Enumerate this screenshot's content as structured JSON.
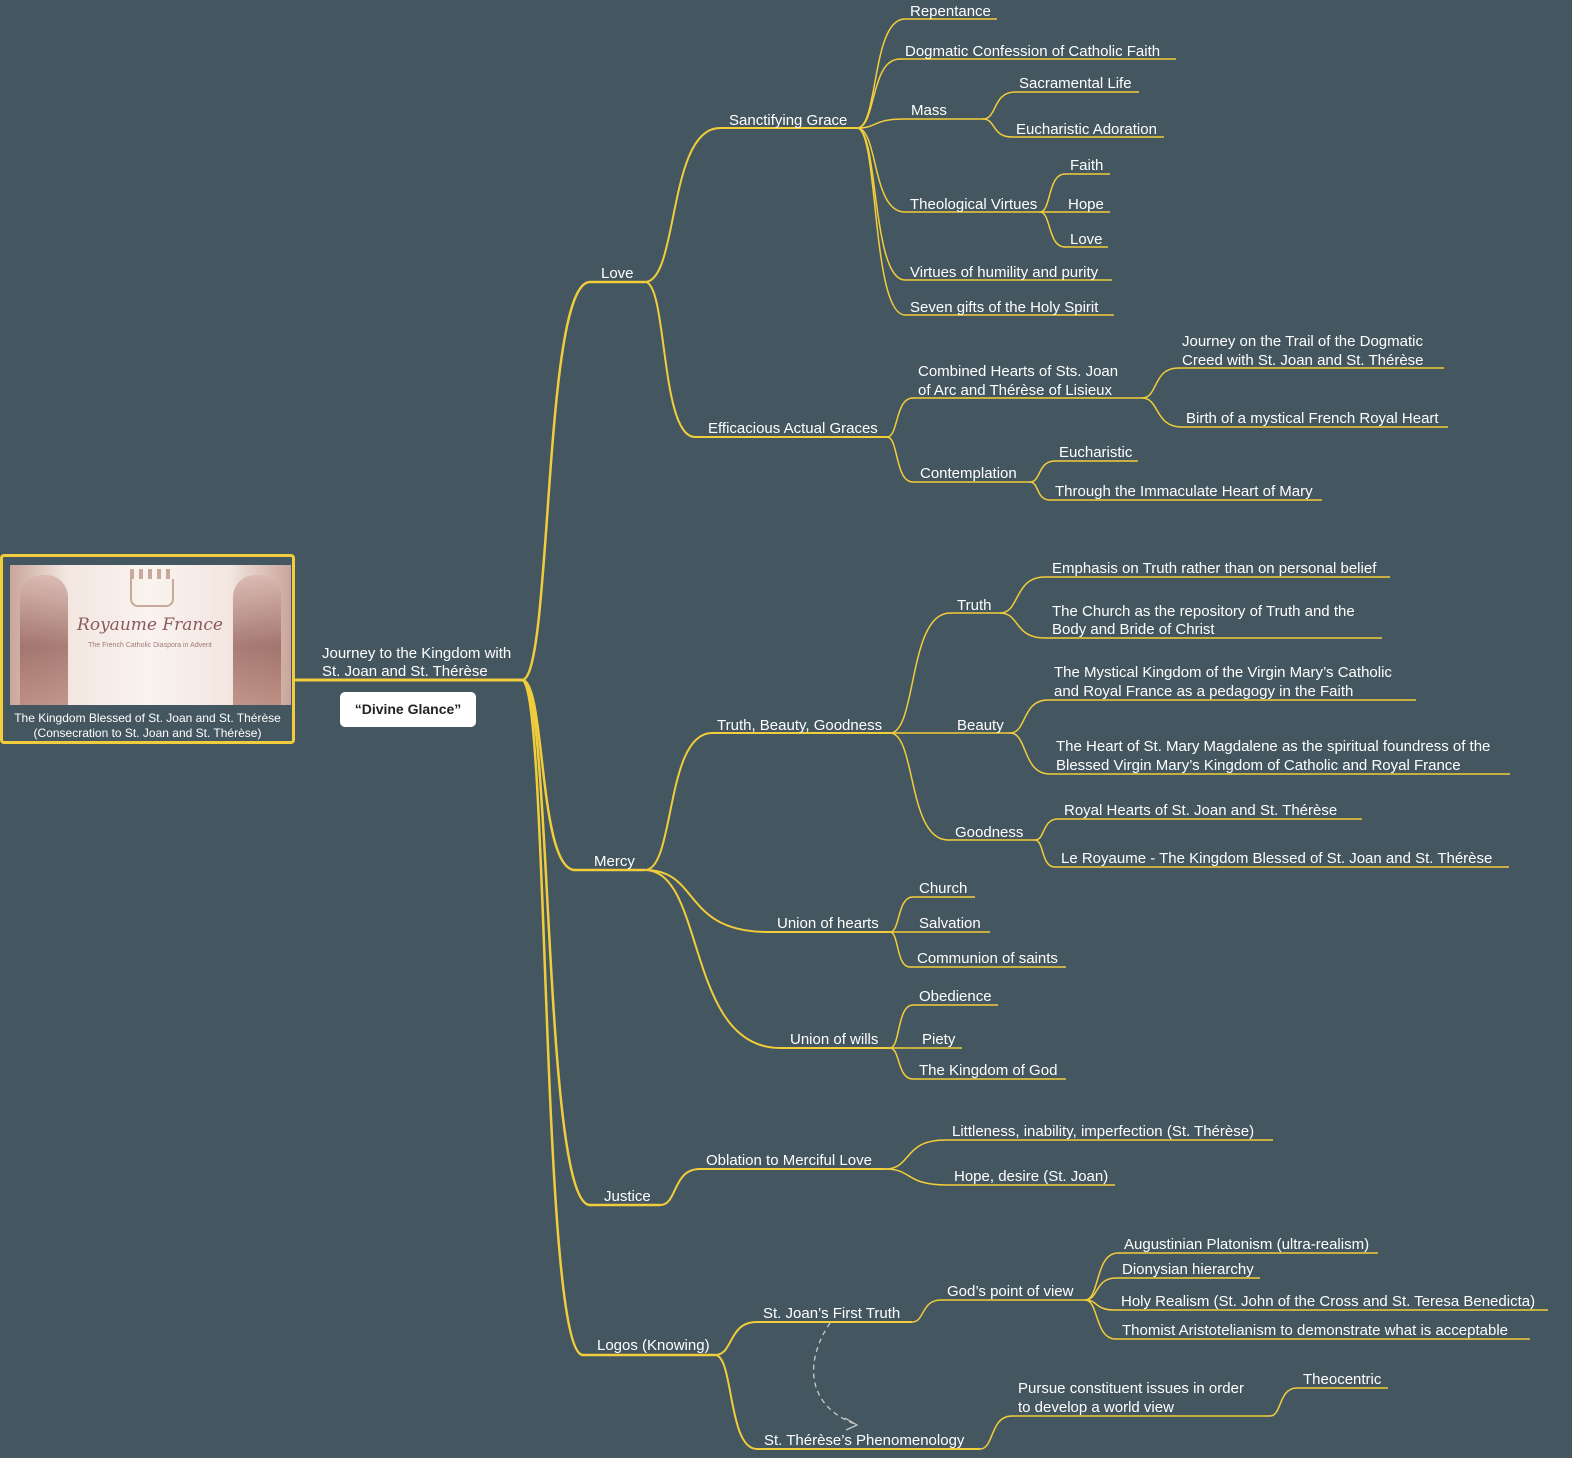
{
  "root": {
    "image_alt": "Royaume France image with St. Joan and St. Thérèse",
    "logo_title": "Royaume France",
    "logo_subtitle": "The French Catholic Diaspora in Advent",
    "caption_line1": "The Kingdom Blessed of St. Joan and St. Thérèse",
    "caption_line2": "(Consecration to St. Joan and St. Thérèse)"
  },
  "central_topic": {
    "line1": "Journey to the Kingdom with",
    "line2": "St. Joan and St. Thérèse"
  },
  "callout": "“Divine Glance”",
  "colors": {
    "background": "#44565f",
    "branch": "#f1cd3c",
    "text": "#ffffff"
  },
  "branches": {
    "love": "Love",
    "sanctifying_grace": "Sanctifying Grace",
    "repentance": "Repentance",
    "dogmatic_confession": "Dogmatic Confession of Catholic Faith",
    "mass": "Mass",
    "sacramental_life": "Sacramental Life",
    "eucharistic_adoration": "Eucharistic Adoration",
    "theological_virtues": "Theological Virtues",
    "faith": "Faith",
    "hope": "Hope",
    "love_virtue": "Love",
    "virtues_humility": "Virtues of humility and purity",
    "seven_gifts": "Seven gifts of the Holy Spirit",
    "efficacious_graces": "Efficacious Actual Graces",
    "combined_hearts_1": "Combined Hearts of Sts. Joan",
    "combined_hearts_2": "of Arc and Thérèse of Lisieux",
    "journey_trail_1": "Journey on the Trail of the Dogmatic",
    "journey_trail_2": "Creed with St. Joan and St. Thérèse",
    "birth_heart": "Birth of a mystical French Royal Heart",
    "contemplation": "Contemplation",
    "eucharistic": "Eucharistic",
    "through_heart": "Through the Immaculate Heart of Mary",
    "mercy": "Mercy",
    "tbg": "Truth, Beauty, Goodness",
    "truth": "Truth",
    "emphasis_truth": "Emphasis on Truth rather than on personal belief",
    "church_repo_1": "The Church as the repository of Truth and the",
    "church_repo_2": "Body and Bride of Christ",
    "beauty": "Beauty",
    "mystical_kingdom_1": "The Mystical Kingdom of the Virgin Mary’s Catholic",
    "mystical_kingdom_2": "and Royal France as a pedagogy in the Faith",
    "heart_magdalene_1": "The Heart of St. Mary Magdalene as the spiritual foundress of the",
    "heart_magdalene_2": "Blessed Virgin Mary’s Kingdom of Catholic and Royal France",
    "goodness": "Goodness",
    "royal_hearts": "Royal  Hearts of St. Joan and St. Thérèse",
    "le_royaume": "Le Royaume - The Kingdom Blessed of St. Joan and St. Thérèse",
    "union_hearts": "Union of hearts",
    "church": "Church",
    "salvation": "Salvation",
    "communion_saints": "Communion of saints",
    "union_wills": "Union of wills",
    "obedience": "Obedience",
    "piety": "Piety",
    "kingdom_god": "The Kingdom of God",
    "justice": "Justice",
    "oblation": "Oblation to Merciful Love",
    "littleness": "Littleness, inability, imperfection (St. Thérèse)",
    "hope_desire": "Hope, desire (St. Joan)",
    "logos": "Logos (Knowing)",
    "joan_first_truth": "St. Joan’s First Truth",
    "gods_view": "God’s point of view",
    "augustinian": "Augustinian Platonism (ultra-realism)",
    "dionysian": "Dionysian hierarchy",
    "holy_realism": "Holy Realism (St. John of the Cross and St. Teresa Benedicta)",
    "thomist": "Thomist Aristotelianism to demonstrate what is acceptable",
    "therese_phenom": "St. Thérèse’s Phenomenology",
    "pursue_1": "Pursue constituent issues in order",
    "pursue_2": "to develop a world view",
    "theocentric": "Theocentric"
  }
}
